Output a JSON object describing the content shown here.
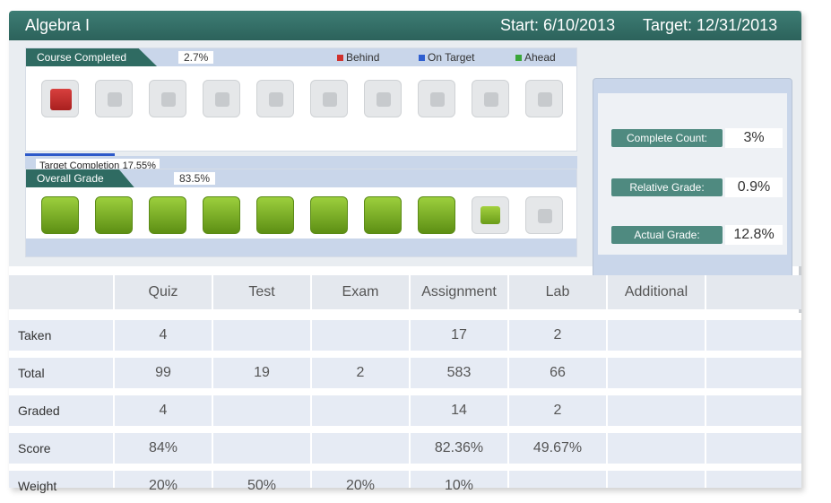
{
  "header": {
    "title": "Algebra I",
    "start": "Start: 6/10/2013",
    "target": "Target: 12/31/2013"
  },
  "course_completed": {
    "label": "Course Completed",
    "percent": "2.7%",
    "legend": [
      {
        "label": "Behind",
        "color": "#d0312d"
      },
      {
        "label": "On Target",
        "color": "#2f5fd0"
      },
      {
        "label": "Ahead",
        "color": "#3aa63a"
      }
    ],
    "boxes": [
      "red",
      "grey",
      "grey",
      "grey",
      "grey",
      "grey",
      "grey",
      "grey",
      "grey",
      "grey"
    ],
    "target_label": "Target Completion",
    "target_value": "17.55%"
  },
  "overall_grade": {
    "label": "Overall Grade",
    "percent": "83.5%",
    "boxes": [
      "green",
      "green",
      "green",
      "green",
      "green",
      "green",
      "green",
      "green",
      "half",
      "grey"
    ]
  },
  "stats": [
    {
      "label": "Complete Count:",
      "value": "3%"
    },
    {
      "label": "Relative Grade:",
      "value": "0.9%"
    },
    {
      "label": "Actual Grade:",
      "value": "12.8%"
    }
  ],
  "table": {
    "columns": [
      "Quiz",
      "Test",
      "Exam",
      "Assignment",
      "Lab",
      "Additional"
    ],
    "rows": [
      {
        "label": "Taken",
        "cells": [
          "4",
          "",
          "",
          "17",
          "2",
          ""
        ]
      },
      {
        "label": "Total",
        "cells": [
          "99",
          "19",
          "2",
          "583",
          "66",
          ""
        ]
      },
      {
        "label": "Graded",
        "cells": [
          "4",
          "",
          "",
          "14",
          "2",
          ""
        ]
      },
      {
        "label": "Score",
        "cells": [
          "84%",
          "",
          "",
          "82.36%",
          "49.67%",
          ""
        ]
      },
      {
        "label": "Weight",
        "cells": [
          "20%",
          "50%",
          "20%",
          "10%",
          "",
          ""
        ]
      }
    ]
  }
}
